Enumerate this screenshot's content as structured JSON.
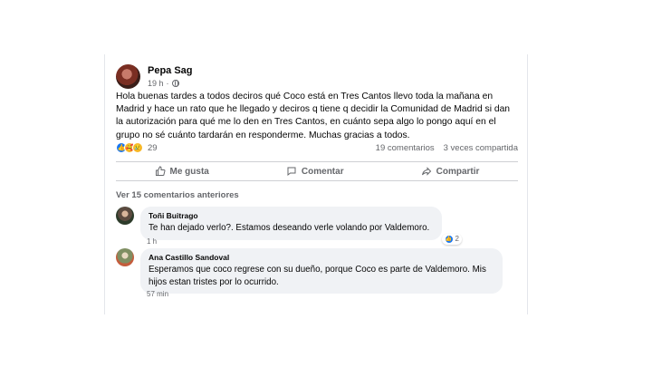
{
  "post": {
    "author": "Pepa Sag",
    "time": "19 h",
    "body": "Hola buenas tardes a todos deciros qué Coco está en Tres Cantos llevo toda la mañana en Madrid y hace un rato que he llegado y deciros q tiene q decidir la Comunidad de Madrid si dan la autorización para qué me lo den en Tres Cantos, en cuánto sepa algo lo pongo aquí en el grupo no sé cuánto tardarán en responderme. Muchas gracias a todos.",
    "reaction_count": "29",
    "comments_count": "19 comentarios",
    "shares_count": "3 veces compartida",
    "more_label": "···"
  },
  "actions": {
    "like": "Me gusta",
    "comment": "Comentar",
    "share": "Compartir"
  },
  "view_more": "Ver 15 comentarios anteriores",
  "comments": [
    {
      "author": "Toñi Buitrago",
      "text": "Te han dejado verlo?. Estamos deseando verle volando por Valdemoro.",
      "time": "1 h",
      "reactions": "2"
    },
    {
      "author": "Ana Castillo Sandoval",
      "text": "Esperamos que coco regrese con su dueño, porque Coco es parte de Valdemoro. Mis hijos estan tristes por lo ocurrido.",
      "time": "57 min"
    }
  ],
  "colors": {
    "like_blue": "#1877f2",
    "secondary_text": "#65676b",
    "bubble_bg": "#f0f2f5"
  },
  "icons": [
    "globe-icon",
    "like-icon",
    "love-icon",
    "sad-icon",
    "comment-icon",
    "share-icon",
    "more-icon"
  ]
}
